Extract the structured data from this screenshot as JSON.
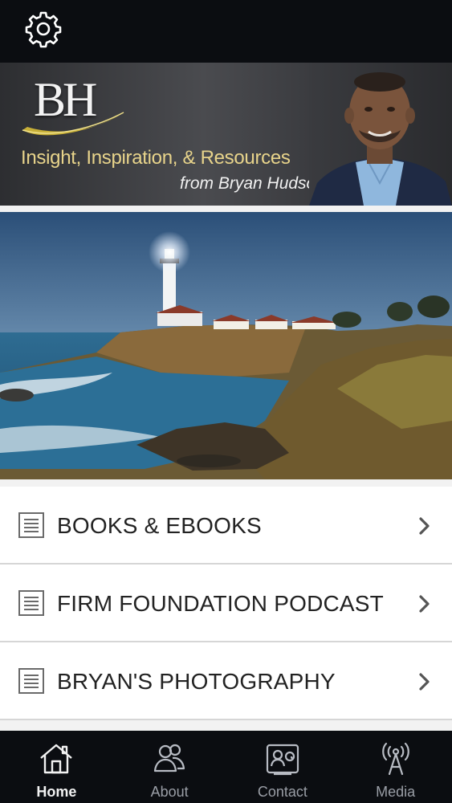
{
  "top_bar": {
    "settings_icon": "gear-icon"
  },
  "header": {
    "logo_text": "BH",
    "tagline": "Insight, Inspiration, & Resources",
    "byline": "from Bryan Hudson",
    "colors": {
      "tagline": "#e8d48b",
      "logo_swoosh": "#c8b038"
    }
  },
  "hero": {
    "image": "lighthouse-coastline-photo"
  },
  "menu": {
    "items": [
      {
        "label": "BOOKS & EBOOKS",
        "icon": "document-icon"
      },
      {
        "label": "FIRM FOUNDATION PODCAST",
        "icon": "document-icon"
      },
      {
        "label": "BRYAN'S PHOTOGRAPHY",
        "icon": "document-icon"
      }
    ]
  },
  "tabbar": {
    "tabs": [
      {
        "label": "Home",
        "icon": "home-icon",
        "active": true
      },
      {
        "label": "About",
        "icon": "people-icon",
        "active": false
      },
      {
        "label": "Contact",
        "icon": "contact-card-icon",
        "active": false
      },
      {
        "label": "Media",
        "icon": "broadcast-tower-icon",
        "active": false
      }
    ]
  }
}
